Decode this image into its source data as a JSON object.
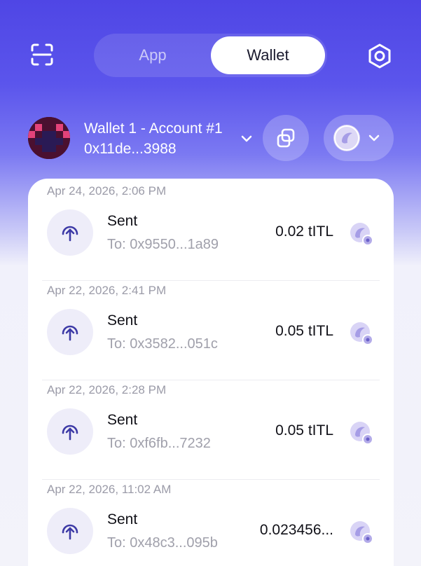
{
  "header": {
    "tabs": [
      {
        "label": "App",
        "active": false
      },
      {
        "label": "Wallet",
        "active": true
      }
    ]
  },
  "account": {
    "name": "Wallet 1 - Account #1",
    "address": "0x11de...3988"
  },
  "colors": {
    "accent": "#4f46e5",
    "token": "#b8b2ec"
  },
  "transactions": [
    {
      "date": "Apr 24, 2026, 2:06 PM",
      "title": "Sent",
      "to": "To: 0x9550...1a89",
      "amount": "0.02 tITL",
      "icon": "arrow-up-icon"
    },
    {
      "date": "Apr 22, 2026, 2:41 PM",
      "title": "Sent",
      "to": "To: 0x3582...051c",
      "amount": "0.05 tITL",
      "icon": "arrow-up-icon"
    },
    {
      "date": "Apr 22, 2026, 2:28 PM",
      "title": "Sent",
      "to": "To: 0xf6fb...7232",
      "amount": "0.05 tITL",
      "icon": "arrow-up-icon"
    },
    {
      "date": "Apr 22, 2026, 11:02 AM",
      "title": "Sent",
      "to": "To: 0x48c3...095b",
      "amount": "0.023456...",
      "icon": "arrow-up-icon"
    }
  ]
}
